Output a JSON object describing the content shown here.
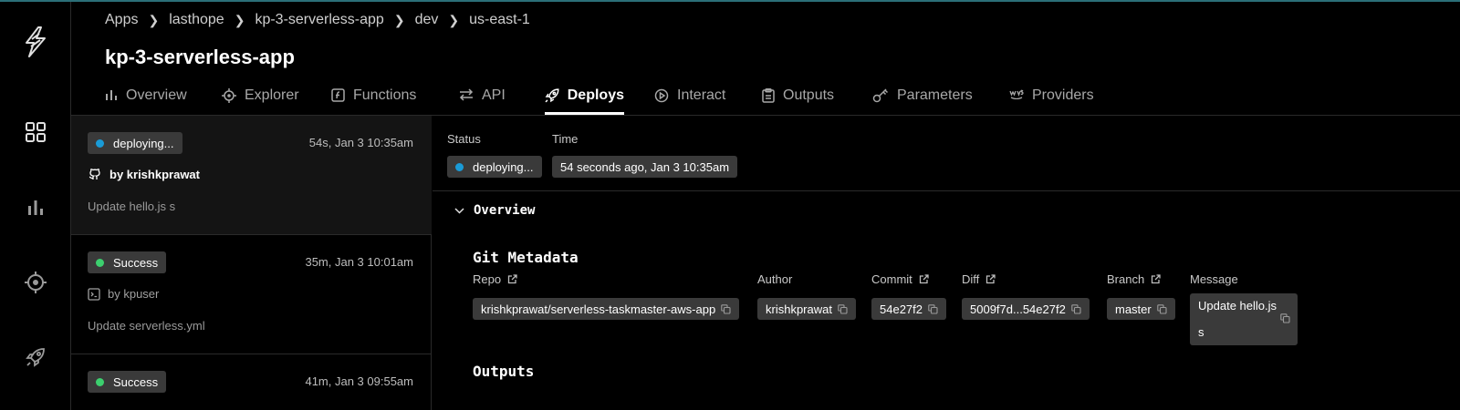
{
  "breadcrumb": [
    "Apps",
    "lasthope",
    "kp-3-serverless-app",
    "dev",
    "us-east-1"
  ],
  "app_title": "kp-3-serverless-app",
  "tabs": [
    {
      "label": "Overview",
      "icon": "bar-chart-icon"
    },
    {
      "label": "Explorer",
      "icon": "crosshair-icon"
    },
    {
      "label": "Functions",
      "icon": "function-icon"
    },
    {
      "label": "API",
      "icon": "arrows-icon"
    },
    {
      "label": "Deploys",
      "icon": "rocket-icon",
      "active": true
    },
    {
      "label": "Interact",
      "icon": "play-circle-icon"
    },
    {
      "label": "Outputs",
      "icon": "clipboard-icon"
    },
    {
      "label": "Parameters",
      "icon": "key-icon"
    },
    {
      "label": "Providers",
      "icon": "aws-icon"
    }
  ],
  "deploys": [
    {
      "status": "deploying...",
      "status_color": "#1a9bd7",
      "time": "54s, Jan 3 10:35am",
      "by": "by krishkprawat",
      "source_icon": "github-icon",
      "message": "Update hello.js s",
      "selected": true
    },
    {
      "status": "Success",
      "status_color": "#3ccf6e",
      "time": "35m, Jan 3 10:01am",
      "by": "by kpuser",
      "source_icon": "terminal-icon",
      "message": "Update serverless.yml",
      "selected": false
    },
    {
      "status": "Success",
      "status_color": "#3ccf6e",
      "time": "41m, Jan 3 09:55am",
      "by": "",
      "source_icon": "",
      "message": "",
      "selected": false
    }
  ],
  "detail": {
    "status_label": "Status",
    "time_label": "Time",
    "status_value": "deploying...",
    "time_value": "54 seconds ago, Jan 3 10:35am",
    "overview_heading": "Overview",
    "git_heading": "Git Metadata",
    "outputs_heading": "Outputs",
    "git": {
      "repo_label": "Repo",
      "repo_value": "krishkprawat/serverless-taskmaster-aws-app",
      "author_label": "Author",
      "author_value": "krishkprawat",
      "commit_label": "Commit",
      "commit_value": "54e27f2",
      "diff_label": "Diff",
      "diff_value": "5009f7d...54e27f2",
      "branch_label": "Branch",
      "branch_value": "master",
      "message_label": "Message",
      "message_line1": "Update hello.js",
      "message_line2": "s"
    }
  },
  "colors": {
    "accent": "#1a9bd7",
    "success": "#3ccf6e",
    "chip": "#3a3a3a"
  }
}
